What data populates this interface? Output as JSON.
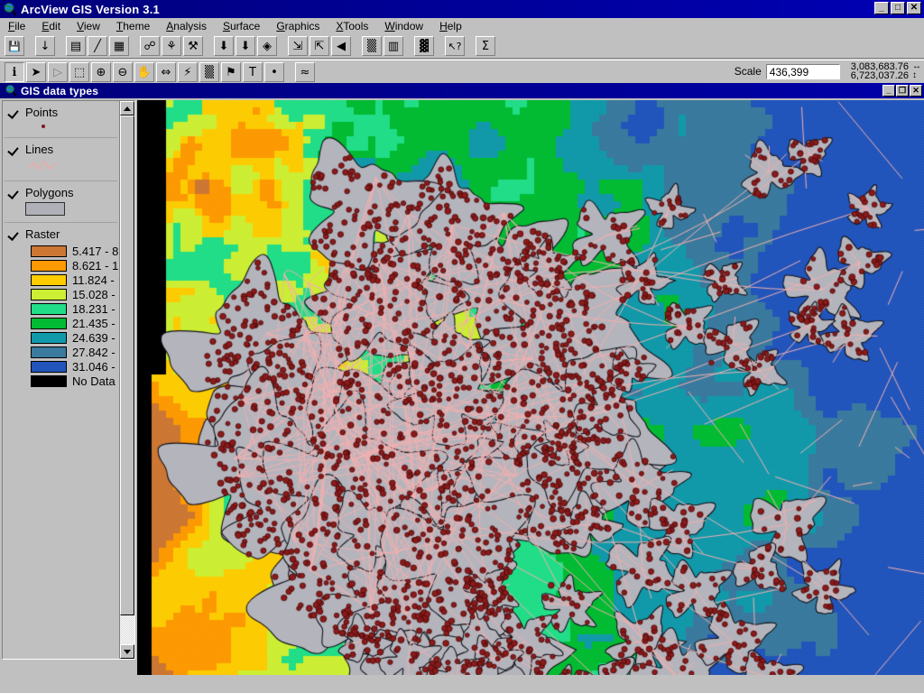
{
  "app": {
    "title": "ArcView GIS Version 3.1",
    "icon": "globe-magnifier-icon",
    "window_buttons": {
      "minimize": "_",
      "maximize": "□",
      "close": "✕"
    }
  },
  "menubar": {
    "items": [
      {
        "label": "File",
        "accel": "F"
      },
      {
        "label": "Edit",
        "accel": "E"
      },
      {
        "label": "View",
        "accel": "V"
      },
      {
        "label": "Theme",
        "accel": "T"
      },
      {
        "label": "Analysis",
        "accel": "A"
      },
      {
        "label": "Surface",
        "accel": "S"
      },
      {
        "label": "Graphics",
        "accel": "G"
      },
      {
        "label": "XTools",
        "accel": "X"
      },
      {
        "label": "Window",
        "accel": "W"
      },
      {
        "label": "Help",
        "accel": "H"
      }
    ]
  },
  "toolbar_main": {
    "buttons": [
      {
        "name": "save-project-button",
        "glyph": "💾"
      },
      {
        "name": "add-theme-button",
        "glyph": "↓"
      },
      {
        "name": "theme-properties-button",
        "glyph": "▤"
      },
      {
        "name": "edit-legend-button",
        "glyph": "╱"
      },
      {
        "name": "open-table-button",
        "glyph": "▦"
      },
      {
        "name": "find-button",
        "glyph": "☍"
      },
      {
        "name": "locate-address-button",
        "glyph": "⚘"
      },
      {
        "name": "query-builder-button",
        "glyph": "⚒"
      },
      {
        "name": "select-features-button",
        "glyph": "⬇"
      },
      {
        "name": "clear-selected-button",
        "glyph": "⬇"
      },
      {
        "name": "zoom-to-themes-button",
        "glyph": "◈"
      },
      {
        "name": "zoom-to-selected-button",
        "glyph": "⇲"
      },
      {
        "name": "zoom-full-extent-button",
        "glyph": "⇱"
      },
      {
        "name": "zoom-previous-button",
        "glyph": "◀"
      },
      {
        "name": "image-analysis-button",
        "glyph": "▒"
      },
      {
        "name": "layout-button",
        "glyph": "▥"
      },
      {
        "name": "histogram-button",
        "glyph": "▓"
      },
      {
        "name": "context-help-button",
        "glyph": "↖?"
      },
      {
        "name": "summary-statistics-button",
        "glyph": "Σ"
      }
    ]
  },
  "toolbar_tools": {
    "buttons": [
      {
        "name": "identify-tool",
        "glyph": "ℹ",
        "state": "pressed"
      },
      {
        "name": "pointer-tool",
        "glyph": "➤",
        "state": "normal"
      },
      {
        "name": "vertex-edit-tool",
        "glyph": "▷",
        "state": "disabled"
      },
      {
        "name": "select-feature-tool",
        "glyph": "⬚",
        "state": "normal"
      },
      {
        "name": "zoom-in-tool",
        "glyph": "⊕",
        "state": "normal"
      },
      {
        "name": "zoom-out-tool",
        "glyph": "⊖",
        "state": "normal"
      },
      {
        "name": "pan-tool",
        "glyph": "✋",
        "state": "normal"
      },
      {
        "name": "measure-tool",
        "glyph": "⇔",
        "state": "normal"
      },
      {
        "name": "hot-link-tool",
        "glyph": "⚡",
        "state": "normal"
      },
      {
        "name": "area-of-interest-tool",
        "glyph": "▒",
        "state": "normal"
      },
      {
        "name": "label-tool",
        "glyph": "⚑",
        "state": "normal"
      },
      {
        "name": "text-tool",
        "glyph": "T",
        "state": "normal"
      },
      {
        "name": "draw-point-tool",
        "glyph": "•",
        "state": "normal"
      },
      {
        "name": "grid-tool",
        "glyph": "≈",
        "state": "normal"
      }
    ]
  },
  "scale": {
    "label": "Scale",
    "value": "436,399",
    "coord_x": "3,083,683.76",
    "coord_y": "6,723,037.26",
    "x_icon": "horizontal-arrows-icon",
    "y_icon": "vertical-arrows-icon"
  },
  "view_window": {
    "title": "GIS data types",
    "icon": "globe-magnifier-icon",
    "buttons": {
      "minimize": "_",
      "restore": "❐",
      "close": "✕"
    }
  },
  "legend": {
    "layers": [
      {
        "name": "Points",
        "checked": true,
        "symbol": "point-symbol"
      },
      {
        "name": "Lines",
        "checked": true,
        "symbol": "line-symbol"
      },
      {
        "name": "Polygons",
        "checked": true,
        "symbol": "polygon-symbol"
      },
      {
        "name": "Raster",
        "checked": true,
        "symbol": "raster-classes"
      }
    ],
    "raster_classes": [
      {
        "label": "5.417 - 8",
        "color": "#cc7733"
      },
      {
        "label": "8.621 - 1",
        "color": "#ff9900"
      },
      {
        "label": "11.824 -",
        "color": "#ffcc00"
      },
      {
        "label": "15.028 -",
        "color": "#ccee33"
      },
      {
        "label": "18.231 - :",
        "color": "#22dd88"
      },
      {
        "label": "21.435 - :",
        "color": "#00bb33"
      },
      {
        "label": "24.639 - :",
        "color": "#1199aa"
      },
      {
        "label": "27.842 - :",
        "color": "#3a7a9e"
      },
      {
        "label": "31.046 - :",
        "color": "#2255bb"
      },
      {
        "label": "No Data",
        "color": "#000000"
      }
    ],
    "symbol_colors": {
      "point": "#7b1b1b",
      "line": "#f0a8a8",
      "polygon_fill": "#b0b0b8",
      "polygon_outline": "#303030"
    },
    "scrollbar": {
      "up": "▲",
      "down": "▼"
    }
  },
  "map": {
    "background": "#000000",
    "nodata_color": "#000000",
    "polygon_fill": "#b4b4bc",
    "polygon_outline": "#101018",
    "road_color": "#f4b0b0",
    "point_color": "#8b1a1a",
    "point_outline": "#3d0808",
    "cell_size": 8,
    "class_colors": [
      "#cc7733",
      "#ff9900",
      "#ffcc00",
      "#ccee33",
      "#22dd88",
      "#00bb33",
      "#1199aa",
      "#3a7a9e",
      "#2255bb",
      "#000000"
    ]
  }
}
